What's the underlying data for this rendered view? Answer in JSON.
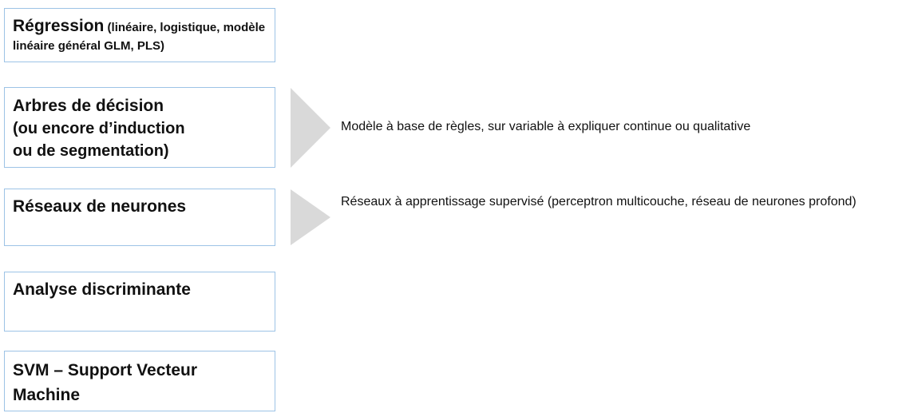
{
  "boxes": {
    "regression": {
      "title": "Régression",
      "subtitle": " (linéaire, logistique, modèle linéaire général GLM, PLS)"
    },
    "arbres": {
      "title": "Arbres de décision",
      "subtitle": "(ou encore d’induction\nou de segmentation)"
    },
    "reseaux": {
      "title": "Réseaux de neurones"
    },
    "analyse": {
      "title": "Analyse discriminante"
    },
    "svm": {
      "title": "SVM – Support Vecteur\nMachine"
    }
  },
  "descriptions": {
    "arbres": "Modèle à base de règles, sur variable à expliquer continue ou qualitative",
    "reseaux": "Réseaux à apprentissage supervisé (perceptron multicouche, réseau de neurones profond)"
  },
  "colors": {
    "box_border": "#9dc3e6",
    "arrow": "#d9d9d9"
  }
}
